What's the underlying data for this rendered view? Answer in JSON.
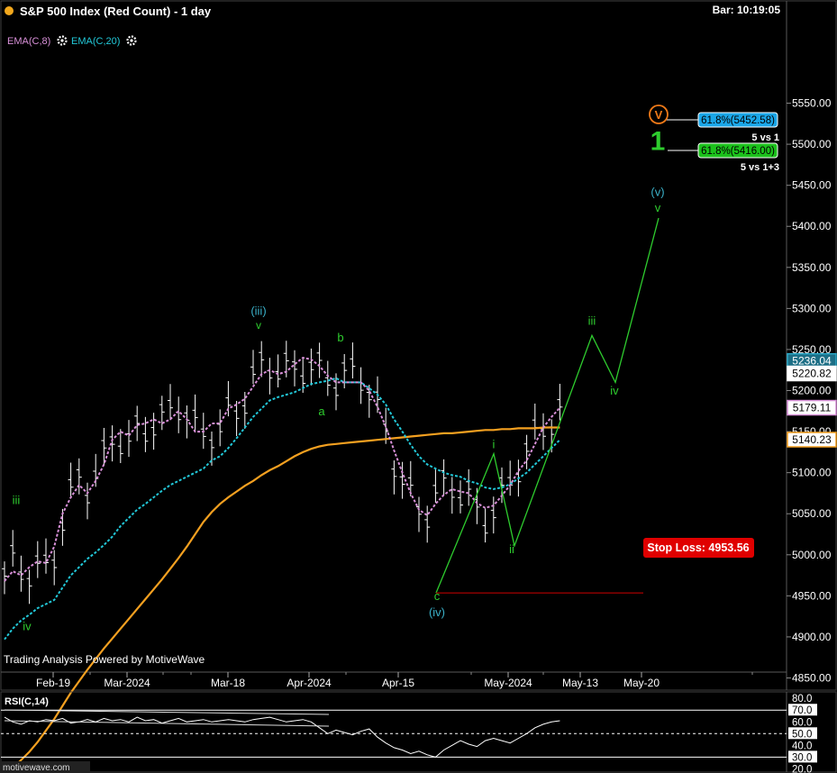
{
  "header": {
    "title": "S&P 500 Index (Red Count) - 1 day",
    "bar_time": "Bar: 10:19:05",
    "indicators": [
      "EMA(C,8)",
      "EMA(C,20)"
    ],
    "watermark": "Trading Analysis Powered by MotiveWave",
    "site": "motivewave.com"
  },
  "colors": {
    "background": "#000000",
    "ema8": "#d890d8",
    "ema20": "#22c8d8",
    "ema_long": "#f4a020",
    "wave_green": "#2ecc2e",
    "wave_cyan": "#3ab0c8",
    "stop_loss": "#e00000",
    "fib_blue": "#1aa6e8",
    "fib_green": "#1cc21c"
  },
  "chart_data": [
    {
      "type": "line",
      "panel": "price",
      "title": "S&P 500 Index (Red Count) - 1 day",
      "x_ticks": [
        "Feb-19",
        "Mar-2024",
        "Mar-18",
        "Apr-2024",
        "Apr-15",
        "May-2024",
        "May-13",
        "May-20"
      ],
      "y_ticks": [
        4850,
        4900,
        4950,
        5000,
        5050,
        5100,
        5150,
        5200,
        5250,
        5300,
        5350,
        5400,
        5450,
        5500,
        5550
      ],
      "ylim": [
        4810,
        5580
      ],
      "price_tags": [
        5236.04,
        5220.82,
        5179.11,
        5140.23
      ],
      "series": [
        {
          "name": "EMA(C,8)",
          "style": "dashed",
          "values": [
            4968,
            4980,
            4975,
            4985,
            4992,
            4990,
            5010,
            5050,
            5070,
            5085,
            5075,
            5090,
            5110,
            5140,
            5150,
            5145,
            5158,
            5160,
            5165,
            5160,
            5165,
            5175,
            5165,
            5150,
            5150,
            5160,
            5160,
            5178,
            5183,
            5190,
            5205,
            5220,
            5225,
            5220,
            5223,
            5232,
            5240,
            5238,
            5230,
            5218,
            5210,
            5210,
            5210,
            5210,
            5200,
            5180,
            5156,
            5127,
            5100,
            5075,
            5055,
            5048,
            5062,
            5073,
            5080,
            5077,
            5075,
            5063,
            5057,
            5060,
            5072,
            5085,
            5102,
            5115,
            5135,
            5155,
            5168,
            5179
          ]
        },
        {
          "name": "EMA(C,20)",
          "style": "dashed",
          "values": [
            4897,
            4910,
            4920,
            4927,
            4935,
            4940,
            4945,
            4960,
            4975,
            4985,
            4995,
            5003,
            5012,
            5022,
            5035,
            5045,
            5055,
            5062,
            5070,
            5078,
            5085,
            5090,
            5095,
            5100,
            5105,
            5115,
            5120,
            5130,
            5142,
            5155,
            5168,
            5178,
            5188,
            5192,
            5195,
            5198,
            5203,
            5208,
            5210,
            5212,
            5215,
            5210,
            5210,
            5210,
            5203,
            5195,
            5183,
            5165,
            5150,
            5134,
            5120,
            5110,
            5105,
            5100,
            5097,
            5095,
            5090,
            5087,
            5082,
            5080,
            5082,
            5086,
            5093,
            5100,
            5110,
            5120,
            5130,
            5140
          ]
        },
        {
          "name": "EMA(long)",
          "style": "solid",
          "values": [
            4730,
            4740,
            4750,
            4760,
            4772,
            4786,
            4800,
            4816,
            4832,
            4846,
            4860,
            4873,
            4886,
            4898,
            4910,
            4922,
            4934,
            4946,
            4958,
            4970,
            4983,
            4996,
            5010,
            5025,
            5040,
            5052,
            5062,
            5070,
            5077,
            5084,
            5090,
            5097,
            5103,
            5108,
            5114,
            5120,
            5125,
            5129,
            5132,
            5134,
            5135,
            5136,
            5137,
            5138,
            5139,
            5140,
            5141,
            5142,
            5143,
            5144,
            5145,
            5146,
            5147,
            5148,
            5148,
            5149,
            5150,
            5151,
            5152,
            5152,
            5153,
            5153,
            5154,
            5154,
            5154,
            5155,
            5155,
            5155
          ]
        }
      ],
      "wave_labels": [
        {
          "label": "iii",
          "color": "green",
          "date": "Feb-14",
          "price": 5062
        },
        {
          "label": "iv",
          "color": "green",
          "date": "Feb-21",
          "price": 4908
        },
        {
          "label": "(iii)",
          "color": "cyan",
          "date": "Mar-20",
          "price": 5292
        },
        {
          "label": "a",
          "color": "green",
          "date": "Apr-02",
          "price": 5170
        },
        {
          "label": "b",
          "color": "green",
          "date": "Apr-04",
          "price": 5260
        },
        {
          "label": "c",
          "color": "green",
          "date": "Apr-19",
          "price": 4945
        },
        {
          "label": "(iv)",
          "color": "cyan",
          "date": "Apr-19",
          "price": 4925
        },
        {
          "label": "i",
          "color": "green",
          "date": "Apr-30",
          "price": 5130
        },
        {
          "label": "ii",
          "color": "green",
          "date": "May-01",
          "price": 5002
        },
        {
          "label": "iii",
          "color": "green",
          "date": "May-16",
          "price": 5280
        },
        {
          "label": "iv",
          "color": "green",
          "date": "May-22",
          "price": 5195
        },
        {
          "label": "(v)",
          "color": "cyan",
          "date": "May-29",
          "price": 5437
        },
        {
          "label": "v",
          "color": "green",
          "date": "May-29",
          "price": 5418
        },
        {
          "label": "1",
          "color": "green",
          "date": "May-29",
          "price": 5493
        }
      ],
      "projection_path": [
        {
          "label": "(iv) low",
          "price": 4953.56
        },
        {
          "label": "i",
          "price": 5123
        },
        {
          "label": "ii",
          "price": 5011
        },
        {
          "label": "iii",
          "price": 5267
        },
        {
          "label": "iv",
          "price": 5210
        },
        {
          "label": "v",
          "price": 5410
        }
      ],
      "annotations": [
        {
          "text": "61.8%(5452.58)",
          "price": 5452.58,
          "note": "5 vs 1"
        },
        {
          "text": "61.8%(5416.00)",
          "price": 5416.0,
          "note": "5 vs 1+3"
        },
        {
          "text": "Stop Loss: 4953.56",
          "price": 4953.56
        }
      ]
    },
    {
      "type": "line",
      "panel": "indicator",
      "title": "RSI(C,14)",
      "y_ticks": [
        20,
        30,
        40,
        50,
        60,
        70,
        80
      ],
      "ylim": [
        18,
        84
      ],
      "levels": [
        70,
        50,
        30
      ],
      "series": [
        {
          "name": "RSI(C,14)",
          "values": [
            64,
            60,
            58,
            61,
            60,
            62,
            61,
            63,
            59,
            60,
            62,
            60,
            63,
            61,
            62,
            60,
            64,
            61,
            62,
            59,
            61,
            63,
            60,
            61,
            62,
            60,
            61,
            62,
            61,
            60,
            62,
            63,
            64,
            62,
            60,
            61,
            62,
            60,
            55,
            50,
            53,
            51,
            49,
            52,
            54,
            47,
            42,
            38,
            36,
            33,
            35,
            32,
            30,
            36,
            40,
            44,
            41,
            39,
            44,
            46,
            44,
            42,
            46,
            50,
            55,
            58,
            60,
            61
          ]
        }
      ]
    }
  ]
}
